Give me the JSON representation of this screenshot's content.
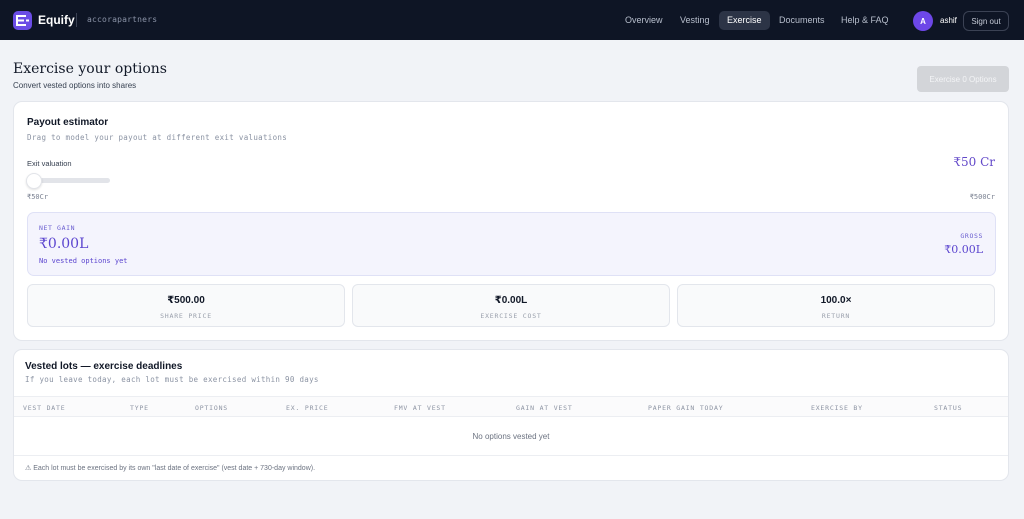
{
  "app": {
    "brand": "Equify",
    "org": "accorapartners"
  },
  "nav": {
    "items": [
      {
        "label": "Overview",
        "active": false
      },
      {
        "label": "Vesting",
        "active": false
      },
      {
        "label": "Exercise",
        "active": true
      },
      {
        "label": "Documents",
        "active": false
      },
      {
        "label": "Help & FAQ",
        "active": false
      }
    ],
    "avatar_initial": "A",
    "username": "ashif",
    "signout_label": "Sign out"
  },
  "page": {
    "title": "Exercise your options",
    "subtitle": "Convert vested options into shares",
    "exercise_button": "Exercise 0 Options"
  },
  "payout": {
    "title": "Payout estimator",
    "subtitle": "Drag to model your payout at different exit valuations",
    "exit_label": "Exit valuation",
    "exit_value": "₹50 Cr",
    "slider_position": 0,
    "range_min": "₹50Cr",
    "range_max": "₹500Cr",
    "net_gain_label": "NET GAIN",
    "net_gain_value": "₹0.00L",
    "net_gain_note": "No vested options yet",
    "gross_label": "GROSS",
    "gross_value": "₹0.00L",
    "stats": [
      {
        "value": "₹500.00",
        "label": "SHARE PRICE"
      },
      {
        "value": "₹0.00L",
        "label": "EXERCISE COST"
      },
      {
        "value": "100.0×",
        "label": "RETURN"
      }
    ]
  },
  "lots": {
    "title": "Vested lots — exercise deadlines",
    "subtitle": "If you leave today, each lot must be exercised within 90 days",
    "columns": [
      "VEST DATE",
      "TYPE",
      "OPTIONS",
      "EX. PRICE",
      "FMV AT VEST",
      "GAIN AT VEST",
      "PAPER GAIN TODAY",
      "EXERCISE BY",
      "STATUS"
    ],
    "empty_text": "No options vested yet",
    "footnote": "⚠ Each lot must be exercised by its own \"last date of exercise\" (vest date + 730-day window)."
  },
  "colors": {
    "nav_bg": "#0e1525",
    "accent": "#6b4de6",
    "gain_text": "#5b45cf",
    "page_bg": "#f1f3f7"
  }
}
